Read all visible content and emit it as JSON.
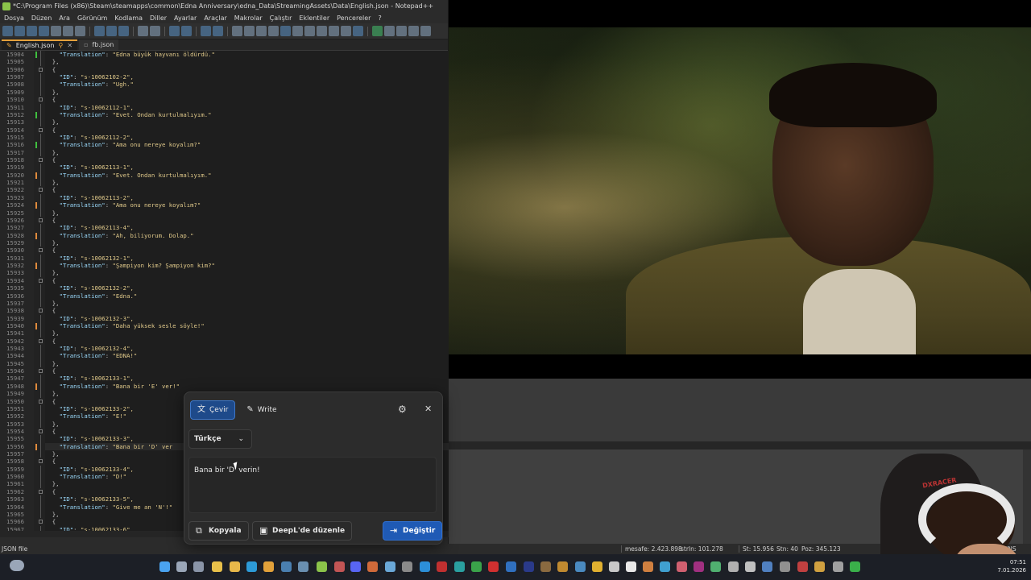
{
  "window": {
    "title": "*C:\\Program Files (x86)\\Steam\\steamapps\\common\\Edna Anniversary\\edna_Data\\StreamingAssets\\Data\\English.json - Notepad++"
  },
  "menu": [
    "Dosya",
    "Düzen",
    "Ara",
    "Görünüm",
    "Kodlama",
    "Diller",
    "Ayarlar",
    "Araçlar",
    "Makrolar",
    "Çalıştır",
    "Eklentiler",
    "Pencereler",
    "?"
  ],
  "tabs": [
    {
      "label": "English.json",
      "active": true
    },
    {
      "label": "fb.json",
      "active": false
    }
  ],
  "editor": {
    "lines": [
      {
        "n": "15904",
        "text": "    \"Translation\": \"Edna büyük hayvanı öldürdü.\"",
        "mark": "g"
      },
      {
        "n": "15905",
        "text": "  },"
      },
      {
        "n": "15906",
        "text": "  {",
        "fold": true
      },
      {
        "n": "15907",
        "text": "    \"ID\": \"s-10062102-2\","
      },
      {
        "n": "15908",
        "text": "    \"Translation\": \"Ugh.\""
      },
      {
        "n": "15909",
        "text": "  },"
      },
      {
        "n": "15910",
        "text": "  {",
        "fold": true
      },
      {
        "n": "15911",
        "text": "    \"ID\": \"s-10062112-1\","
      },
      {
        "n": "15912",
        "text": "    \"Translation\": \"Evet. Ondan kurtulmalıyım.\"",
        "mark": "g"
      },
      {
        "n": "15913",
        "text": "  },"
      },
      {
        "n": "15914",
        "text": "  {",
        "fold": true
      },
      {
        "n": "15915",
        "text": "    \"ID\": \"s-10062112-2\","
      },
      {
        "n": "15916",
        "text": "    \"Translation\": \"Ama onu nereye koyalım?\"",
        "mark": "g"
      },
      {
        "n": "15917",
        "text": "  },"
      },
      {
        "n": "15918",
        "text": "  {",
        "fold": true
      },
      {
        "n": "15919",
        "text": "    \"ID\": \"s-10062113-1\","
      },
      {
        "n": "15920",
        "text": "    \"Translation\": \"Evet. Ondan kurtulmalıyım.\"",
        "mark": "o"
      },
      {
        "n": "15921",
        "text": "  },"
      },
      {
        "n": "15922",
        "text": "  {",
        "fold": true
      },
      {
        "n": "15923",
        "text": "    \"ID\": \"s-10062113-2\","
      },
      {
        "n": "15924",
        "text": "    \"Translation\": \"Ama onu nereye koyalım?\"",
        "mark": "o"
      },
      {
        "n": "15925",
        "text": "  },"
      },
      {
        "n": "15926",
        "text": "  {",
        "fold": true
      },
      {
        "n": "15927",
        "text": "    \"ID\": \"s-10062113-4\","
      },
      {
        "n": "15928",
        "text": "    \"Translation\": \"Ah, biliyorum. Dolap.\"",
        "mark": "o"
      },
      {
        "n": "15929",
        "text": "  },"
      },
      {
        "n": "15930",
        "text": "  {",
        "fold": true
      },
      {
        "n": "15931",
        "text": "    \"ID\": \"s-10062132-1\","
      },
      {
        "n": "15932",
        "text": "    \"Translation\": \"Şampiyon kim? Şampiyon kim?\"",
        "mark": "o"
      },
      {
        "n": "15933",
        "text": "  },"
      },
      {
        "n": "15934",
        "text": "  {",
        "fold": true
      },
      {
        "n": "15935",
        "text": "    \"ID\": \"s-10062132-2\","
      },
      {
        "n": "15936",
        "text": "    \"Translation\": \"Edna.\""
      },
      {
        "n": "15937",
        "text": "  },"
      },
      {
        "n": "15938",
        "text": "  {",
        "fold": true
      },
      {
        "n": "15939",
        "text": "    \"ID\": \"s-10062132-3\","
      },
      {
        "n": "15940",
        "text": "    \"Translation\": \"Daha yüksek sesle söyle!\"",
        "mark": "o"
      },
      {
        "n": "15941",
        "text": "  },"
      },
      {
        "n": "15942",
        "text": "  {",
        "fold": true
      },
      {
        "n": "15943",
        "text": "    \"ID\": \"s-10062132-4\","
      },
      {
        "n": "15944",
        "text": "    \"Translation\": \"EDNA!\""
      },
      {
        "n": "15945",
        "text": "  },"
      },
      {
        "n": "15946",
        "text": "  {",
        "fold": true
      },
      {
        "n": "15947",
        "text": "    \"ID\": \"s-10062133-1\","
      },
      {
        "n": "15948",
        "text": "    \"Translation\": \"Bana bir 'E' ver!\"",
        "mark": "o"
      },
      {
        "n": "15949",
        "text": "  },"
      },
      {
        "n": "15950",
        "text": "  {",
        "fold": true
      },
      {
        "n": "15951",
        "text": "    \"ID\": \"s-10062133-2\","
      },
      {
        "n": "15952",
        "text": "    \"Translation\": \"E!\""
      },
      {
        "n": "15953",
        "text": "  },"
      },
      {
        "n": "15954",
        "text": "  {",
        "fold": true
      },
      {
        "n": "15955",
        "text": "    \"ID\": \"s-10062133-3\","
      },
      {
        "n": "15956",
        "text": "    \"Translation\": \"Bana bir 'D' ver",
        "mark": "o",
        "hl": true
      },
      {
        "n": "15957",
        "text": "  },"
      },
      {
        "n": "15958",
        "text": "  {",
        "fold": true
      },
      {
        "n": "15959",
        "text": "    \"ID\": \"s-10062133-4\","
      },
      {
        "n": "15960",
        "text": "    \"Translation\": \"D!\""
      },
      {
        "n": "15961",
        "text": "  },"
      },
      {
        "n": "15962",
        "text": "  {",
        "fold": true
      },
      {
        "n": "15963",
        "text": "    \"ID\": \"s-10062133-5\","
      },
      {
        "n": "15964",
        "text": "    \"Translation\": \"Give me an 'N'!\""
      },
      {
        "n": "15965",
        "text": "  },"
      },
      {
        "n": "15966",
        "text": "  {",
        "fold": true
      },
      {
        "n": "15967",
        "text": "    \"ID\": \"s-10062133-6\","
      }
    ]
  },
  "statusbar": {
    "file_type": "JSON file",
    "length": "mesafe: 2.423.898",
    "lines": "strIn: 101.278",
    "line_col": "St: 15.956",
    "col": "Stn: 40",
    "pos": "Poz: 345.123",
    "mode": "INS"
  },
  "deepl": {
    "tab_translate": "Çevir",
    "tab_write": "Write",
    "language": "Türkçe",
    "translation_text": "Bana bir 'D' verin!",
    "copy_button": "Kopyala",
    "edit_button": "DeepL'de düzenle",
    "replace_button": "Değiştir"
  },
  "taskbar": {
    "time": "07:51",
    "date": "7.01.2026"
  },
  "colors": {
    "accent": "#1f5ab5",
    "modified_marker": "#e08a3c",
    "saved_marker": "#3fbf3f"
  }
}
